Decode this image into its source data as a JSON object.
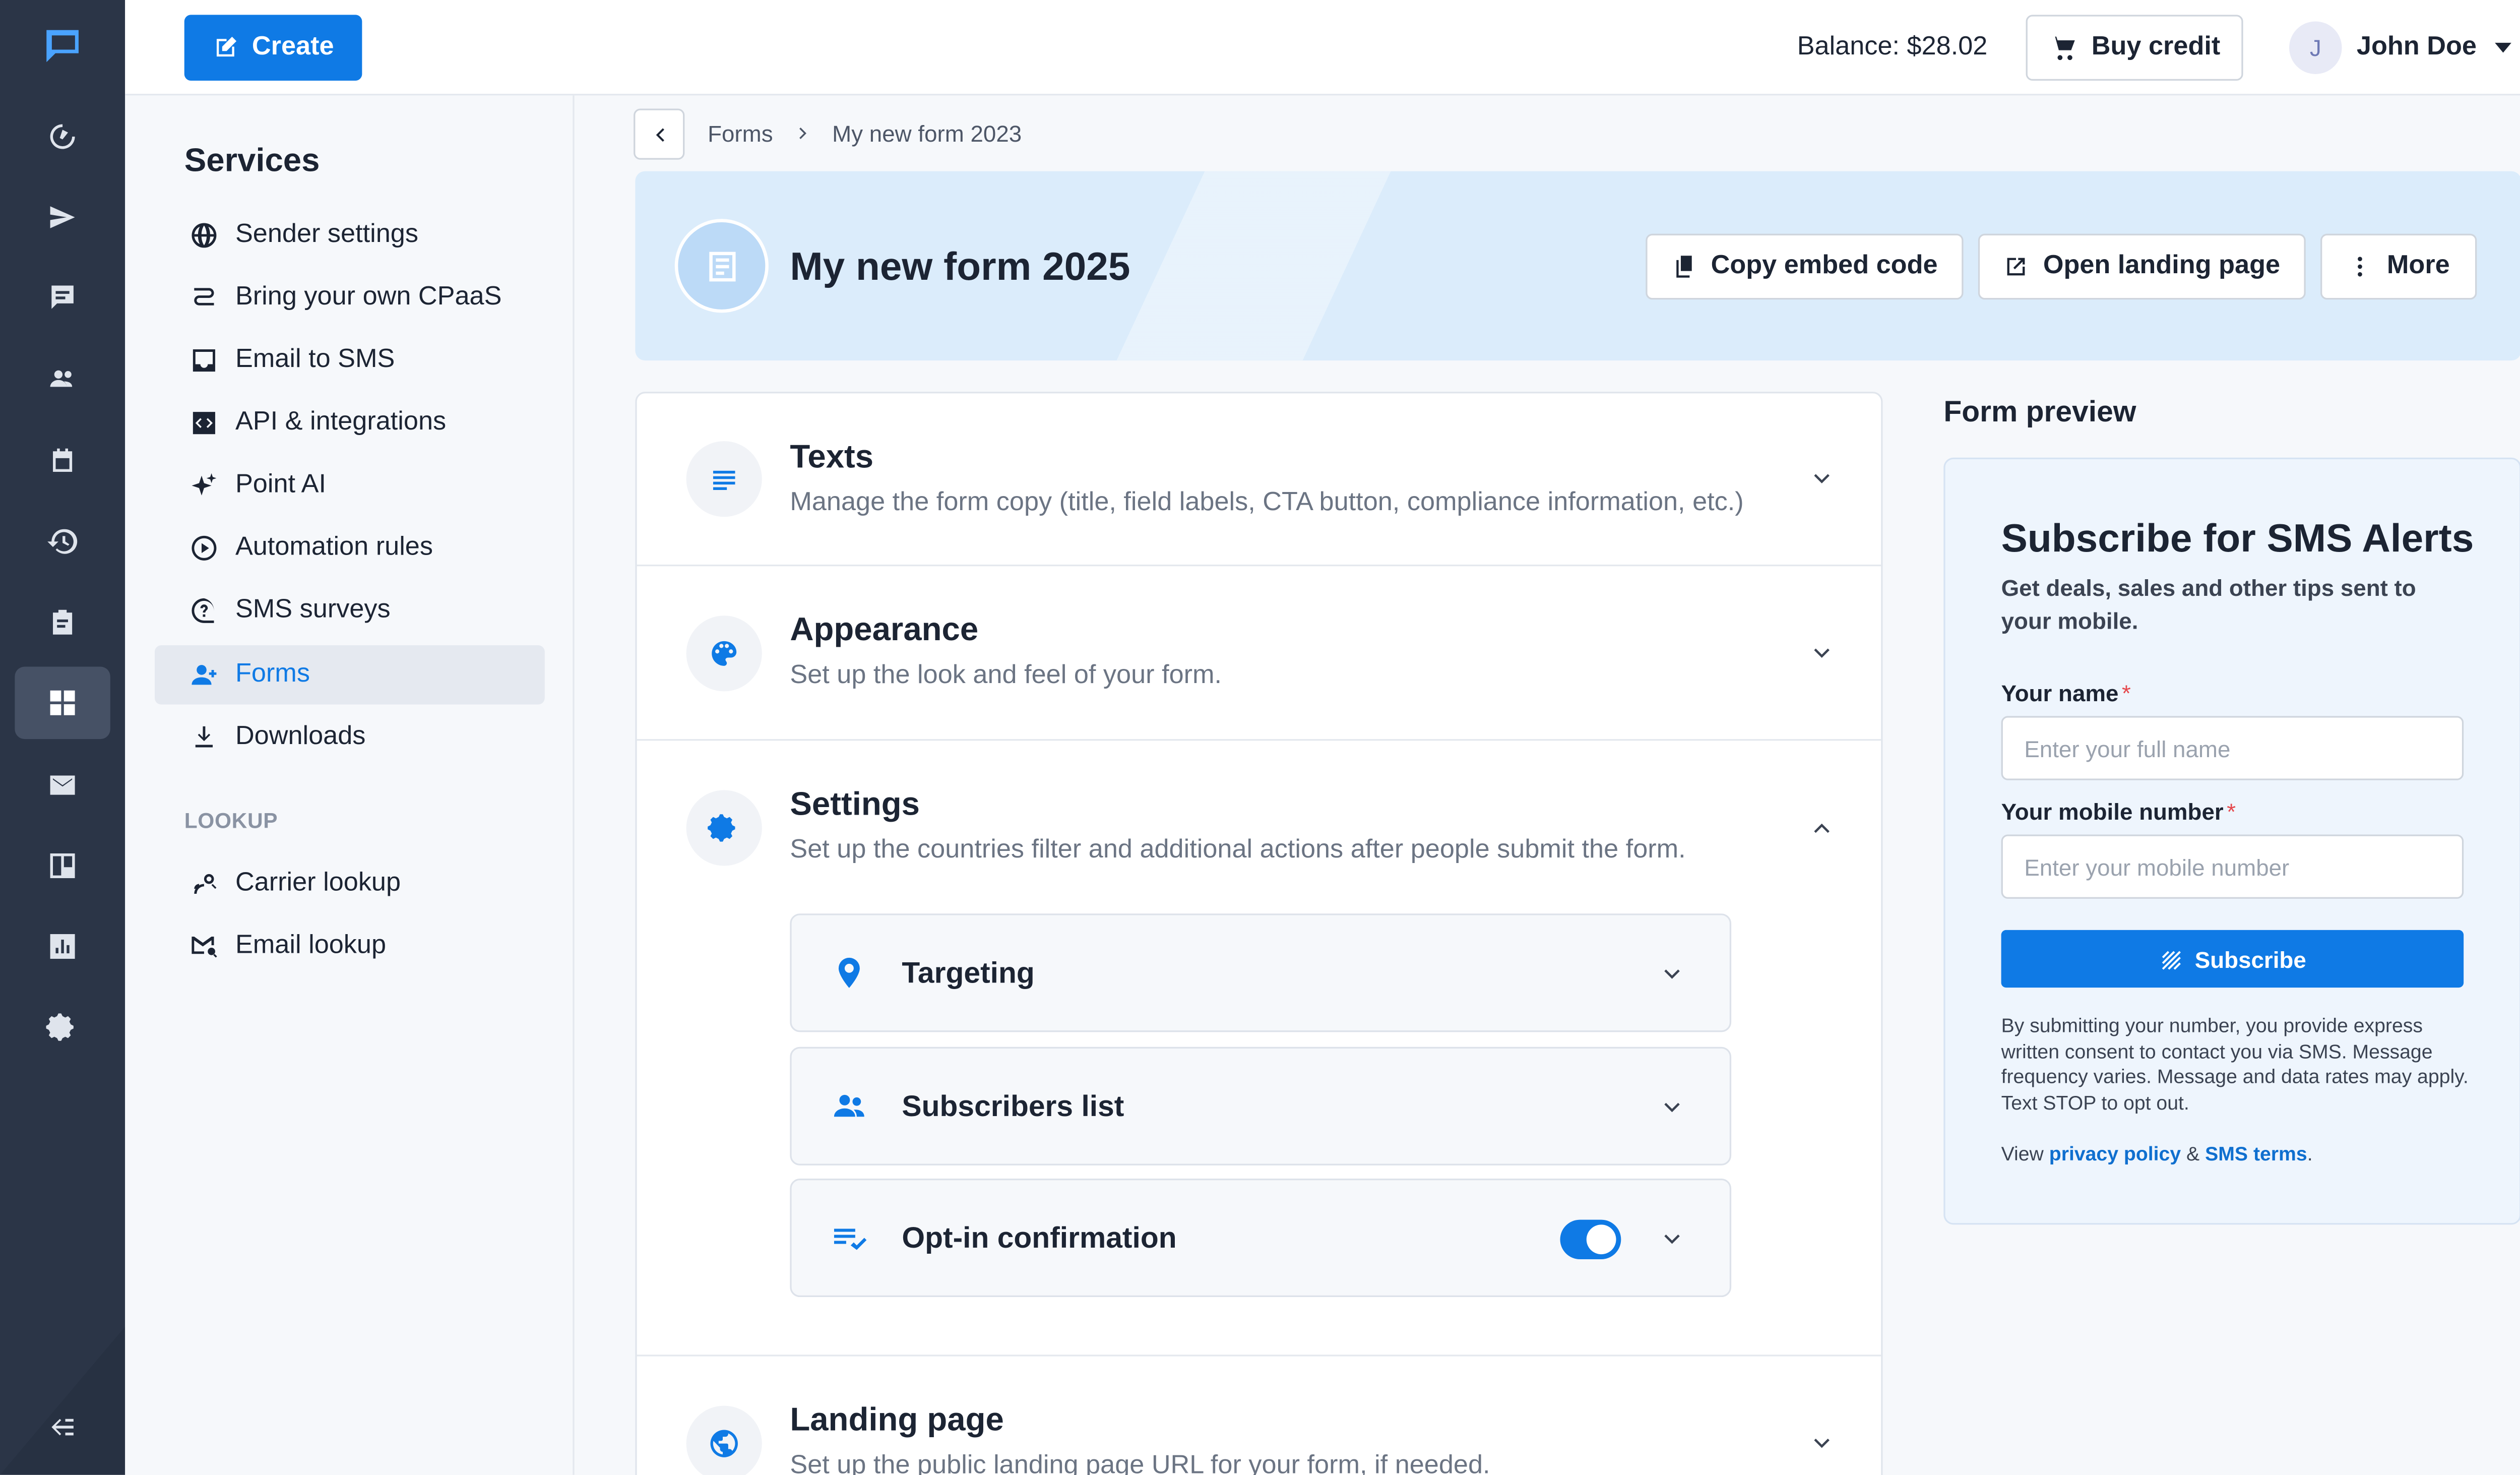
{
  "topbar": {
    "create_label": "Create",
    "balance": "Balance: $28.02",
    "buy_credit_label": "Buy credit",
    "user_initial": "J",
    "user_name": "John Doe"
  },
  "rail": {
    "icons": [
      "logo-icon",
      "dashboard-icon",
      "send-icon",
      "chat-icon",
      "contacts-icon",
      "calendar-icon",
      "history-icon",
      "clipboard-icon",
      "services-icon",
      "mail-icon",
      "templates-icon",
      "reports-icon",
      "settings-icon",
      "collapse-icon"
    ],
    "active": "services-icon"
  },
  "services": {
    "title": "Services",
    "items": [
      {
        "label": "Sender settings",
        "icon": "globe-icon"
      },
      {
        "label": "Bring your own CPaaS",
        "icon": "route-icon"
      },
      {
        "label": "Email to SMS",
        "icon": "inbox-icon"
      },
      {
        "label": "API & integrations",
        "icon": "code-icon"
      },
      {
        "label": "Point AI",
        "icon": "sparkle-icon"
      },
      {
        "label": "Automation rules",
        "icon": "automation-icon"
      },
      {
        "label": "SMS surveys",
        "icon": "question-icon"
      },
      {
        "label": "Forms",
        "icon": "person-add-icon",
        "active": true
      },
      {
        "label": "Downloads",
        "icon": "download-icon"
      }
    ],
    "group_label": "LOOKUP",
    "lookup_items": [
      {
        "label": "Carrier lookup",
        "icon": "carrier-icon"
      },
      {
        "label": "Email lookup",
        "icon": "email-search-icon"
      }
    ]
  },
  "breadcrumb": {
    "parent": "Forms",
    "current": "My new form 2023"
  },
  "hero": {
    "title": "My new form 2025",
    "copy_embed": "Copy embed code",
    "open_landing": "Open landing page",
    "more": "More"
  },
  "sections": {
    "texts": {
      "title": "Texts",
      "desc": "Manage the form copy (title, field labels, CTA button, compliance information, etc.)"
    },
    "appearance": {
      "title": "Appearance",
      "desc": "Set up the look and feel of your form."
    },
    "settings": {
      "title": "Settings",
      "desc": "Set up the countries filter and additional actions after people submit the form.",
      "subs": {
        "targeting": "Targeting",
        "subscribers": "Subscribers list",
        "optin": "Opt-in confirmation",
        "optin_enabled": true
      }
    },
    "landing": {
      "title": "Landing page",
      "desc": "Set up the public landing page URL for your form, if needed."
    }
  },
  "preview": {
    "label": "Form preview",
    "title": "Subscribe for SMS Alerts",
    "subtitle": "Get deals, sales and other tips sent to your mobile.",
    "name_label": "Your name",
    "name_placeholder": "Enter your full name",
    "mobile_label": "Your mobile number",
    "mobile_placeholder": "Enter your mobile number",
    "required_mark": "*",
    "subscribe_label": "Subscribe",
    "legal": "By submitting your number, you provide express written consent to contact you via SMS. Message frequency varies. Message and data rates may apply. Text STOP to opt out.",
    "view_prefix": "View",
    "privacy_link": "privacy policy",
    "amp": "&",
    "sms_terms_link": "SMS terms",
    "period": "."
  },
  "colors": {
    "primary": "#0f7ae5",
    "rail": "#2b3547",
    "hero": "#dbecfb"
  }
}
